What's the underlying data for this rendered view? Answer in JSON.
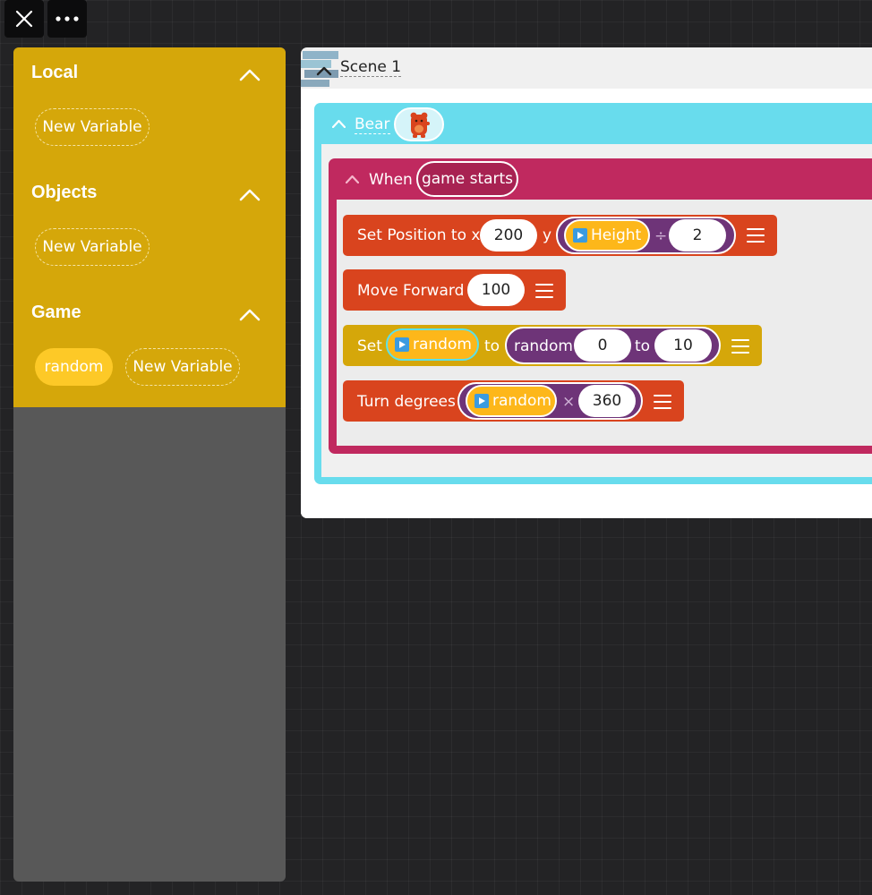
{
  "topbar": {
    "close_icon": "close-icon",
    "more_icon": "more-icon"
  },
  "variables_panel": {
    "sections": [
      {
        "title": "Local",
        "new_variable_label": "New Variable"
      },
      {
        "title": "Objects",
        "new_variable_label": "New Variable"
      },
      {
        "title": "Game",
        "variables": [
          "random"
        ],
        "new_variable_label": "New Variable"
      }
    ],
    "colors": {
      "panel": "#d5a70a",
      "empty": "#585858",
      "variable": "#fdc927"
    }
  },
  "scene": {
    "title": "Scene 1"
  },
  "object": {
    "name": "Bear",
    "color": "#68dced"
  },
  "rule": {
    "when_label": "When",
    "event": "game starts",
    "color": "#c0295f"
  },
  "actions": [
    {
      "name": "Set Position",
      "label": "Set Position to x",
      "x": "200",
      "y_label": "y",
      "y_expr": {
        "variable": "Height",
        "op": "÷",
        "value": "2"
      }
    },
    {
      "name": "Move Forward",
      "label": "Move Forward",
      "value": "100"
    },
    {
      "name": "Set",
      "label": "Set",
      "target": "random",
      "to_label": "to",
      "expr": {
        "fn": "random",
        "min": "0",
        "mid_label": "to",
        "max": "10"
      }
    },
    {
      "name": "Turn degrees",
      "label": "Turn degrees",
      "expr": {
        "variable": "random",
        "op": "×",
        "value": "360"
      }
    }
  ],
  "colors": {
    "action_red": "#d9441e",
    "action_yellow": "#d5a70a",
    "math_purple": "#6e3478",
    "variable_blue": "#3b9be0"
  }
}
